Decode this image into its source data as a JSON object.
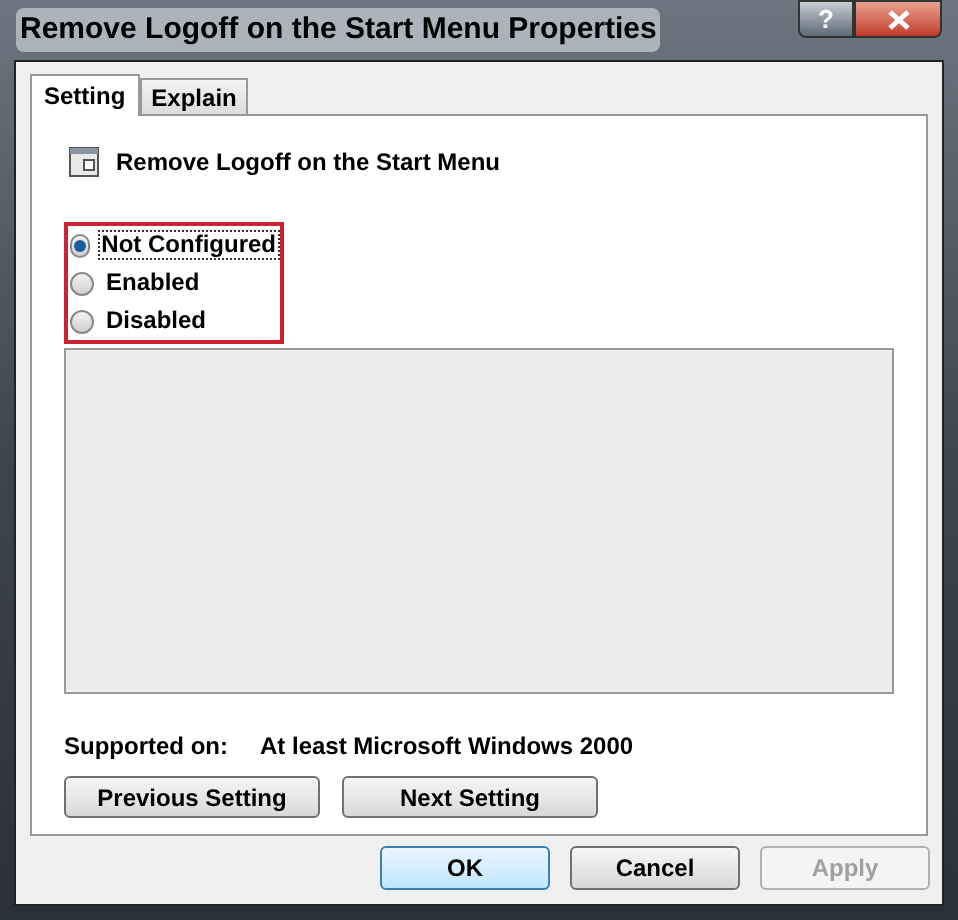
{
  "window": {
    "title": "Remove Logoff on the Start Menu Properties",
    "help_button": "?"
  },
  "tabs": [
    {
      "label": "Setting",
      "selected": true
    },
    {
      "label": "Explain",
      "selected": false
    }
  ],
  "policy": {
    "title": "Remove Logoff on the Start Menu"
  },
  "options": [
    {
      "label": "Not Configured",
      "selected": true
    },
    {
      "label": "Enabled",
      "selected": false
    },
    {
      "label": "Disabled",
      "selected": false
    }
  ],
  "supported": {
    "label": "Supported on:",
    "value": "At least Microsoft Windows 2000"
  },
  "nav_buttons": [
    "Previous Setting",
    "Next Setting"
  ],
  "dialog_buttons": [
    {
      "label": "OK",
      "disabled": false,
      "default": true
    },
    {
      "label": "Cancel",
      "disabled": false,
      "default": false
    },
    {
      "label": "Apply",
      "disabled": true,
      "default": false
    }
  ]
}
